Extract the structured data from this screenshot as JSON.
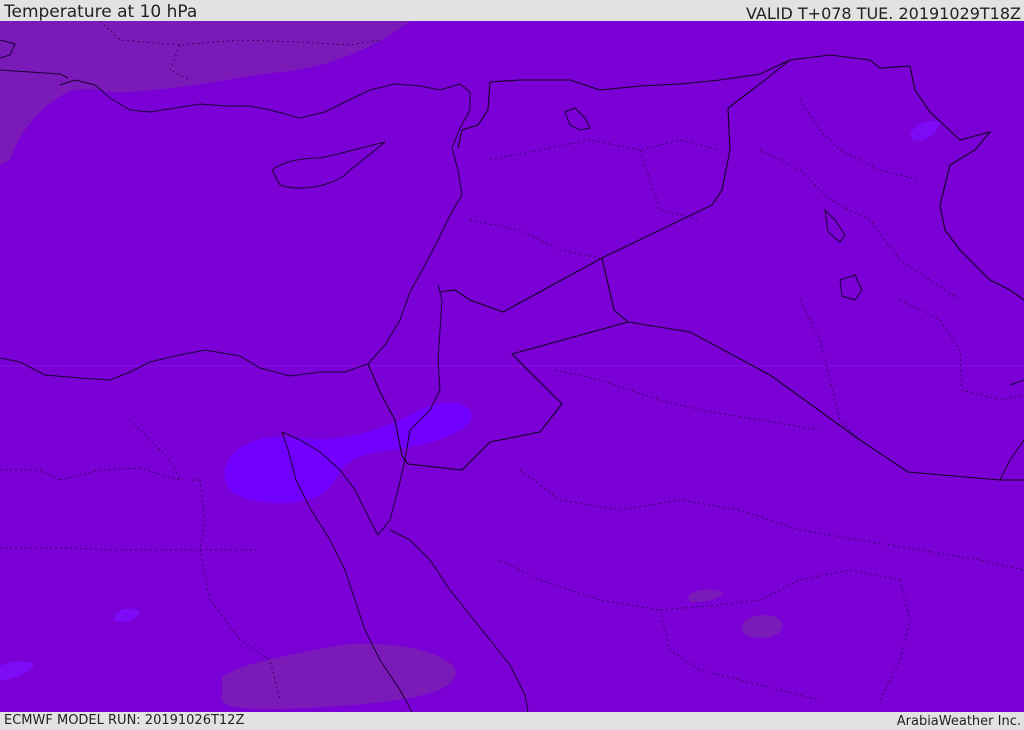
{
  "header": {
    "title": "Temperature at 10 hPa",
    "valid": "VALID T+078 TUE. 20191029T18Z"
  },
  "footer": {
    "model_run": "ECMWF MODEL RUN: 20191026T12Z",
    "credit": "ArabiaWeather Inc."
  },
  "colors": {
    "base_field": "#7a00d6",
    "warm_field": "#7a1ab8",
    "cool_field": "#7d0bf6",
    "cold_field": "#7100ff",
    "coastline": "#1a0033",
    "border": "#120024"
  }
}
